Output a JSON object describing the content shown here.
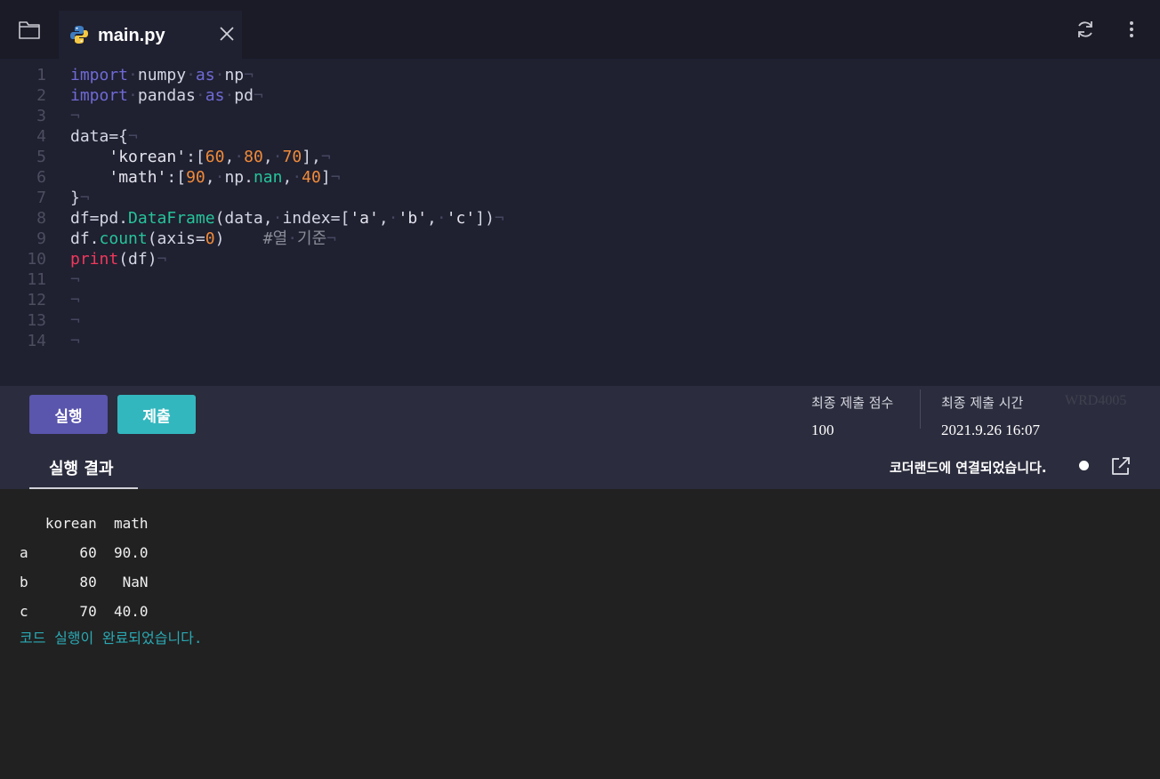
{
  "tab": {
    "filename": "main.py"
  },
  "icons": {
    "folder": "folder-icon",
    "python": "python-icon",
    "close": "close-icon",
    "refresh": "refresh-icon",
    "more": "more-vertical-icon",
    "external": "external-link-icon"
  },
  "editor": {
    "lines": [
      {
        "n": "1",
        "tokens": [
          {
            "t": "import",
            "c": "kw"
          },
          {
            "t": "·",
            "c": "ws"
          },
          {
            "t": "numpy"
          },
          {
            "t": "·",
            "c": "ws"
          },
          {
            "t": "as",
            "c": "kw"
          },
          {
            "t": "·",
            "c": "ws"
          },
          {
            "t": "np"
          },
          {
            "t": "¬",
            "c": "ws"
          }
        ]
      },
      {
        "n": "2",
        "tokens": [
          {
            "t": "import",
            "c": "kw"
          },
          {
            "t": "·",
            "c": "ws"
          },
          {
            "t": "pandas"
          },
          {
            "t": "·",
            "c": "ws"
          },
          {
            "t": "as",
            "c": "kw"
          },
          {
            "t": "·",
            "c": "ws"
          },
          {
            "t": "pd"
          },
          {
            "t": "¬",
            "c": "ws"
          }
        ]
      },
      {
        "n": "3",
        "tokens": [
          {
            "t": "¬",
            "c": "ws"
          }
        ]
      },
      {
        "n": "4",
        "tokens": [
          {
            "t": "data={"
          },
          {
            "t": "¬",
            "c": "ws"
          }
        ]
      },
      {
        "n": "5",
        "tokens": [
          {
            "t": "    "
          },
          {
            "t": "'korean'",
            "c": "str"
          },
          {
            "t": ":["
          },
          {
            "t": "60",
            "c": "num"
          },
          {
            "t": ","
          },
          {
            "t": "·",
            "c": "ws"
          },
          {
            "t": "80",
            "c": "num"
          },
          {
            "t": ","
          },
          {
            "t": "·",
            "c": "ws"
          },
          {
            "t": "70",
            "c": "num"
          },
          {
            "t": "],"
          },
          {
            "t": "¬",
            "c": "ws"
          }
        ]
      },
      {
        "n": "6",
        "tokens": [
          {
            "t": "    "
          },
          {
            "t": "'math'",
            "c": "str"
          },
          {
            "t": ":["
          },
          {
            "t": "90",
            "c": "num"
          },
          {
            "t": ","
          },
          {
            "t": "·",
            "c": "ws"
          },
          {
            "t": "np."
          },
          {
            "t": "nan",
            "c": "fn"
          },
          {
            "t": ","
          },
          {
            "t": "·",
            "c": "ws"
          },
          {
            "t": "40",
            "c": "num"
          },
          {
            "t": "]"
          },
          {
            "t": "¬",
            "c": "ws"
          }
        ]
      },
      {
        "n": "7",
        "tokens": [
          {
            "t": "}"
          },
          {
            "t": "¬",
            "c": "ws"
          }
        ]
      },
      {
        "n": "8",
        "tokens": [
          {
            "t": "df=pd."
          },
          {
            "t": "DataFrame",
            "c": "fn"
          },
          {
            "t": "(data,"
          },
          {
            "t": "·",
            "c": "ws"
          },
          {
            "t": "index=["
          },
          {
            "t": "'a'",
            "c": "str"
          },
          {
            "t": ","
          },
          {
            "t": "·",
            "c": "ws"
          },
          {
            "t": "'b'",
            "c": "str"
          },
          {
            "t": ","
          },
          {
            "t": "·",
            "c": "ws"
          },
          {
            "t": "'c'",
            "c": "str"
          },
          {
            "t": "])"
          },
          {
            "t": "¬",
            "c": "ws"
          }
        ]
      },
      {
        "n": "9",
        "tokens": [
          {
            "t": "df."
          },
          {
            "t": "count",
            "c": "fn"
          },
          {
            "t": "(axis="
          },
          {
            "t": "0",
            "c": "num"
          },
          {
            "t": ")"
          },
          {
            "t": "    "
          },
          {
            "t": "#열",
            "c": "cm"
          },
          {
            "t": "·",
            "c": "ws"
          },
          {
            "t": "기준",
            "c": "cm"
          },
          {
            "t": "¬",
            "c": "ws"
          }
        ]
      },
      {
        "n": "10",
        "tokens": [
          {
            "t": "print",
            "c": "pr"
          },
          {
            "t": "(df)"
          },
          {
            "t": "¬",
            "c": "ws"
          }
        ]
      },
      {
        "n": "11",
        "tokens": [
          {
            "t": "¬",
            "c": "ws"
          }
        ]
      },
      {
        "n": "12",
        "tokens": [
          {
            "t": "¬",
            "c": "ws"
          }
        ]
      },
      {
        "n": "13",
        "tokens": [
          {
            "t": "¬",
            "c": "ws"
          }
        ]
      },
      {
        "n": "14",
        "tokens": [
          {
            "t": "¬",
            "c": "ws"
          }
        ]
      }
    ]
  },
  "actions": {
    "run_label": "실행",
    "submit_label": "제출"
  },
  "meta": {
    "score_label": "최종 제출 점수",
    "score_value": "100",
    "time_label": "최종 제출 시간",
    "time_value": "2021.9.26 16:07",
    "watermark": "WRD4005"
  },
  "results": {
    "tab_label": "실행 결과",
    "connection_status": "코더랜드에 연결되었습니다.",
    "output_lines": [
      "   korean  math",
      "a      60  90.0",
      "b      80   NaN",
      "c      70  40.0"
    ],
    "done_message": "코드 실행이 완료되었습니다."
  }
}
